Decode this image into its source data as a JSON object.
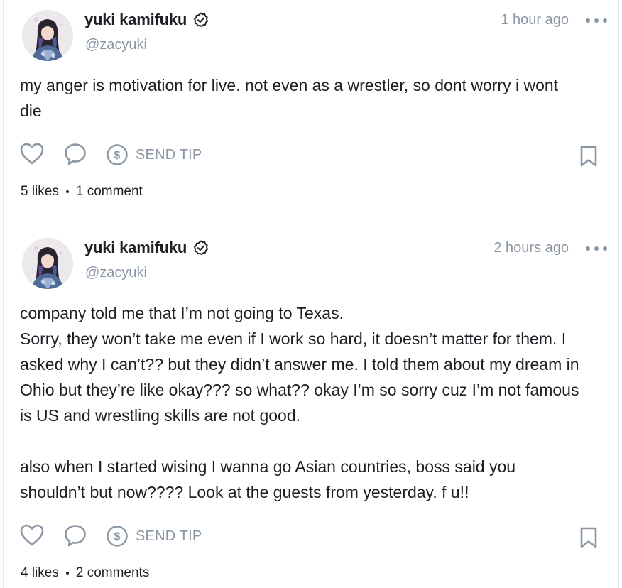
{
  "posts": [
    {
      "author": "yuki kamifuku",
      "handle": "@zacyuki",
      "time": "1 hour ago",
      "text": "my anger is motivation for live. not even as a wrestler, so dont worry i wont\ndie",
      "tip_label": "SEND TIP",
      "likes": "5 likes",
      "comments": "1 comment"
    },
    {
      "author": "yuki kamifuku",
      "handle": "@zacyuki",
      "time": "2 hours ago",
      "text": "company told me that I’m not going to Texas.\nSorry, they won’t take me even if I work so hard, it doesn’t matter for them. I\nasked why I can’t?? but they didn’t answer me. I told them about my dream in\nOhio but they’re like okay??? so what?? okay I’m so sorry cuz I’m not famous\nis US and wrestling skills are not good.\n\nalso when I started wising I wanna go Asian countries, boss said you\nshouldn’t but now???? Look at the guests from yesterday. f u!!",
      "tip_label": "SEND TIP",
      "likes": "4 likes",
      "comments": "2 comments"
    }
  ],
  "icons": {
    "verified": "verified-badge-icon",
    "more": "more-horizontal-icon",
    "like": "heart-icon",
    "comment": "comment-bubble-icon",
    "tip": "dollar-circle-icon",
    "bookmark": "bookmark-icon"
  },
  "colors": {
    "text": "#1d1f24",
    "muted": "#8a96a3",
    "border": "#e6e7ea"
  }
}
